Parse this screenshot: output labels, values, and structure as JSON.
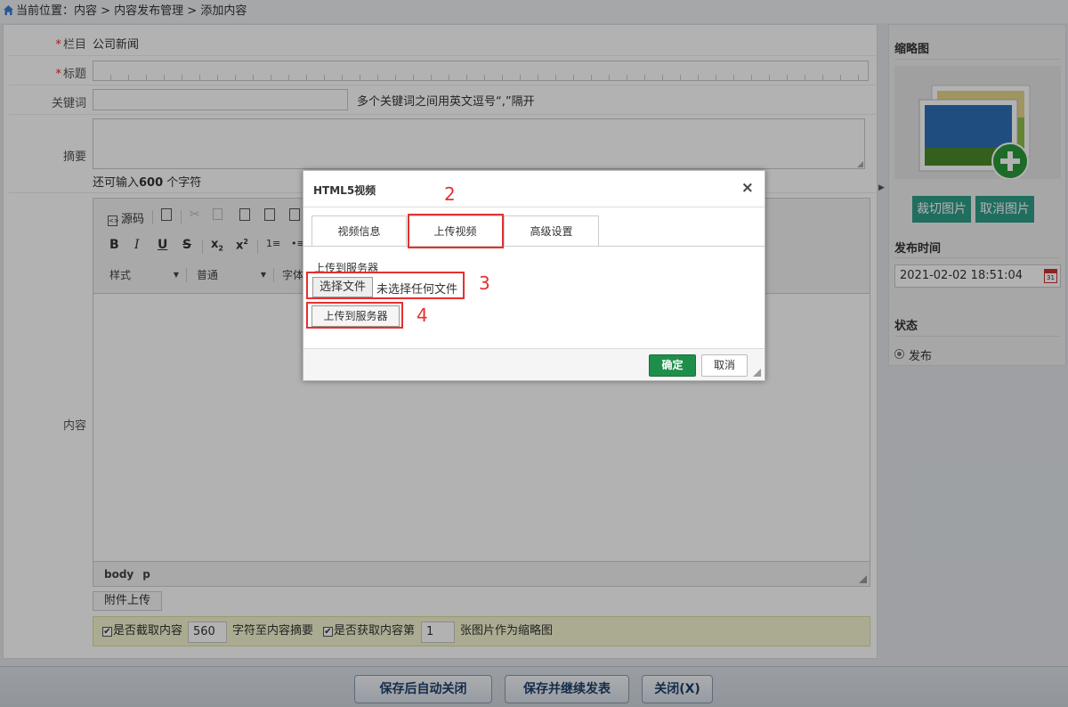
{
  "breadcrumb": {
    "text": "当前位置：内容 > 内容发布管理 > 添加内容"
  },
  "form": {
    "column_label": "栏目",
    "column_value": "公司新闻",
    "title_label": "标题",
    "required_mark": "*",
    "keywords_label": "关键词",
    "keywords_hint": "多个关键词之间用英文逗号“,”隔开",
    "summary_label": "摘要",
    "remaining_prefix": "还可输入",
    "remaining_count": "600",
    "remaining_suffix": " 个字符",
    "content_label": "内容"
  },
  "editor": {
    "source_label": "源码",
    "style_combo": "样式",
    "format_combo": "普通",
    "font_combo_partial": "字体",
    "path_items": [
      "body",
      "p"
    ]
  },
  "attach_button": "附件上传",
  "options": {
    "opt1_text": "是否截取内容",
    "opt1_value": "560",
    "opt1_suffix": "字符至内容摘要",
    "opt2_text": "是否获取内容第",
    "opt2_value": "1",
    "opt2_suffix": "张图片作为缩略图"
  },
  "sidebar": {
    "thumb_title": "缩略图",
    "crop_button": "裁切图片",
    "cancel_image_button": "取消图片",
    "publish_time_title": "发布时间",
    "publish_time_value": "2021-02-02 18:51:04",
    "calendar_day": "31",
    "status_title": "状态",
    "status_option": "发布"
  },
  "bottom_buttons": {
    "save_close": "保存后自动关闭",
    "save_continue": "保存并继续发表",
    "close": "关闭(X)"
  },
  "dialog": {
    "title": "HTML5视频",
    "close_glyph": "×",
    "tabs": [
      "视频信息",
      "上传视频",
      "高级设置"
    ],
    "upload_section_label": "上传到服务器",
    "choose_file_button": "选择文件",
    "no_file_text": "未选择任何文件",
    "upload_button": "上传到服务器",
    "ok_button": "确定",
    "cancel_button": "取消"
  },
  "annotations": {
    "step2": "2",
    "step3": "3",
    "step4": "4",
    "color": "#e53030"
  },
  "colors": {
    "accent_green": "#2e9e86",
    "ok_green": "#1e8f4a",
    "nav_text": "#1e3f6b"
  }
}
